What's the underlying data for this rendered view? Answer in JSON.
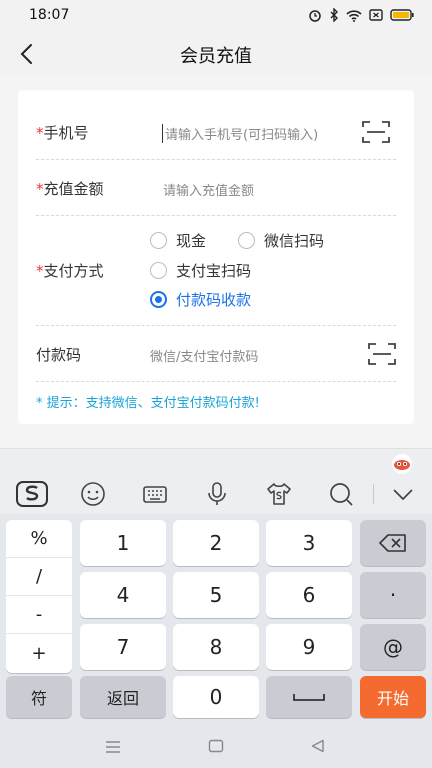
{
  "status_bar": {
    "time": "18:07"
  },
  "nav": {
    "title": "会员充值"
  },
  "form": {
    "phone": {
      "required": "*",
      "label": "手机号",
      "placeholder": "请输入手机号(可扫码输入)"
    },
    "amount": {
      "required": "*",
      "label": "充值金额",
      "placeholder": "请输入充值金额"
    },
    "payment": {
      "required": "*",
      "label": "支付方式",
      "options": [
        {
          "label": "现金",
          "selected": false
        },
        {
          "label": "微信扫码",
          "selected": false
        },
        {
          "label": "支付宝扫码",
          "selected": false
        },
        {
          "label": "付款码收款",
          "selected": true
        }
      ]
    },
    "paycode": {
      "label": "付款码",
      "placeholder": "微信/支付宝付款码"
    },
    "tip": "* 提示：支持微信、支付宝付款码付款!"
  },
  "keyboard": {
    "symbols": [
      "%",
      "/",
      "-",
      "+"
    ],
    "digits": [
      "1",
      "2",
      "3",
      "4",
      "5",
      "6",
      "7",
      "8",
      "9",
      "0"
    ],
    "dot": "·",
    "at": "@",
    "sym_key": "符",
    "back_key": "返回",
    "start_key": "开始"
  },
  "colors": {
    "accent": "#1a73e8",
    "required": "#e53935",
    "tip": "#1aa3d9",
    "start_key": "#f56a2e"
  }
}
